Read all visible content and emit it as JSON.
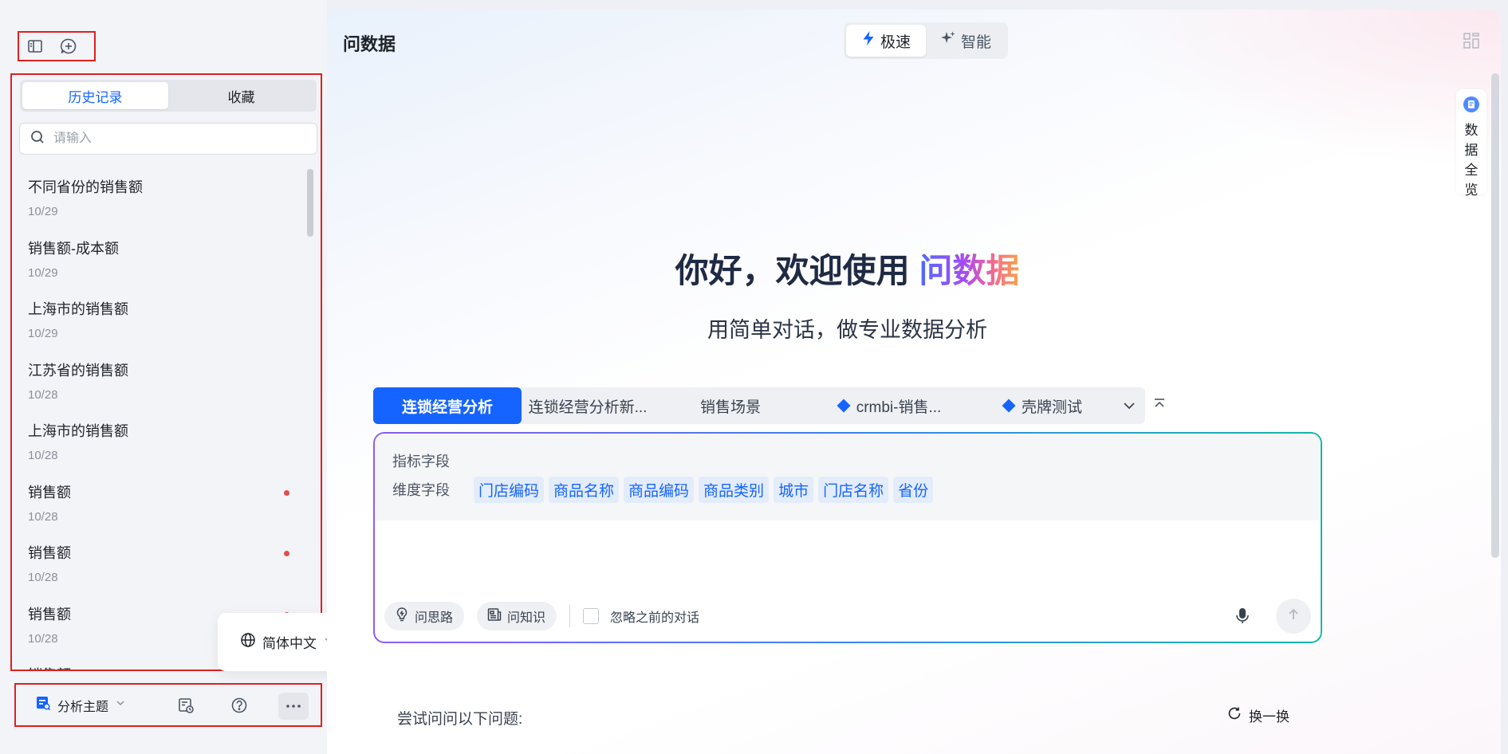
{
  "sidebar": {
    "tabs": [
      {
        "label": "历史记录",
        "active": true
      },
      {
        "label": "收藏",
        "active": false
      }
    ],
    "search": {
      "placeholder": "请输入"
    },
    "history": [
      {
        "title": "不同省份的销售额",
        "date": "10/29",
        "unread": false
      },
      {
        "title": "销售额-成本额",
        "date": "10/29",
        "unread": false
      },
      {
        "title": "上海市的销售额",
        "date": "10/29",
        "unread": false
      },
      {
        "title": "江苏省的销售额",
        "date": "10/28",
        "unread": false
      },
      {
        "title": "上海市的销售额",
        "date": "10/28",
        "unread": false
      },
      {
        "title": "销售额",
        "date": "10/28",
        "unread": true
      },
      {
        "title": "销售额",
        "date": "10/28",
        "unread": true
      },
      {
        "title": "销售额",
        "date": "10/28",
        "unread": true
      },
      {
        "title": "销售额",
        "date": "",
        "unread": false
      }
    ],
    "bottom": {
      "theme_label": "分析主题"
    },
    "language_popup": {
      "label": "简体中文"
    }
  },
  "main": {
    "title": "问数据",
    "modes": [
      {
        "label": "极速",
        "active": true
      },
      {
        "label": "智能",
        "active": false
      }
    ],
    "side_card_label": "数据全览",
    "hero": {
      "greeting": "你好，欢迎使用 ",
      "brand": "问数据",
      "subtitle": "用简单对话，做专业数据分析"
    },
    "topics": [
      {
        "label": "连锁经营分析",
        "active": true,
        "icon": false
      },
      {
        "label": "连锁经营分析新...",
        "active": false,
        "icon": false
      },
      {
        "label": "销售场景",
        "active": false,
        "icon": false
      },
      {
        "label": "crmbi-销售...",
        "active": false,
        "icon": true
      },
      {
        "label": "壳牌测试",
        "active": false,
        "icon": true
      }
    ],
    "input": {
      "metric_label": "指标字段",
      "dimension_label": "维度字段",
      "dimensions": [
        "门店编码",
        "商品名称",
        "商品编码",
        "商品类别",
        "城市",
        "门店名称",
        "省份"
      ],
      "ask_path_label": "问思路",
      "ask_knowledge_label": "问知识",
      "ignore_label": "忽略之前的对话"
    },
    "suggest": {
      "label": "尝试问问以下问题:",
      "refresh_label": "换一换"
    }
  },
  "colors": {
    "accent": "#1664ff",
    "highlight_border": "#e02020"
  }
}
